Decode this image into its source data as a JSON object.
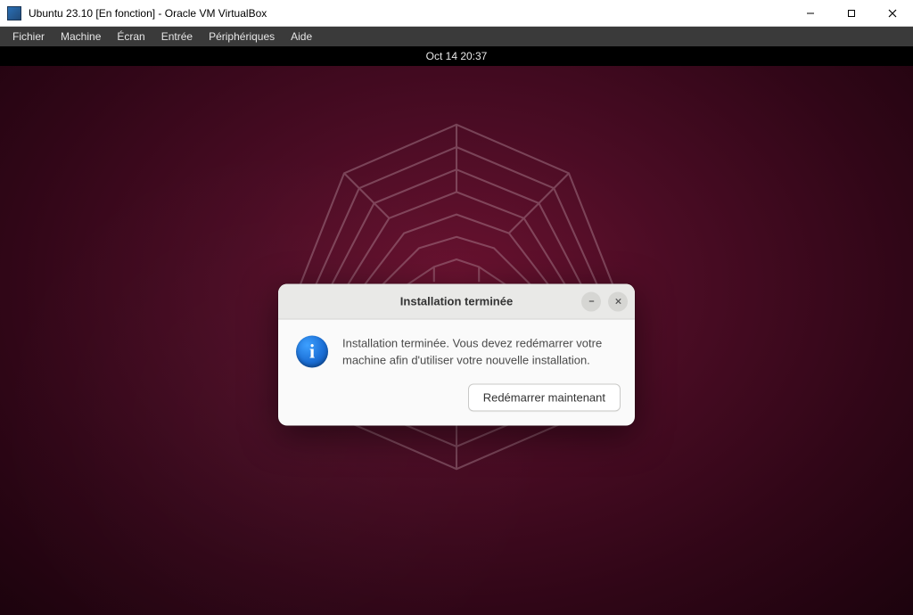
{
  "host_window": {
    "title": "Ubuntu 23.10 [En fonction] - Oracle VM VirtualBox"
  },
  "vbox_menu": {
    "items": [
      "Fichier",
      "Machine",
      "Écran",
      "Entrée",
      "Périphériques",
      "Aide"
    ]
  },
  "gnome": {
    "clock": "Oct 14  20:37"
  },
  "dialog": {
    "title": "Installation terminée",
    "message": "Installation terminée. Vous devez redémarrer votre machine afin d'utiliser votre nouvelle installation.",
    "info_glyph": "i",
    "restart_label": "Redémarrer maintenant"
  }
}
